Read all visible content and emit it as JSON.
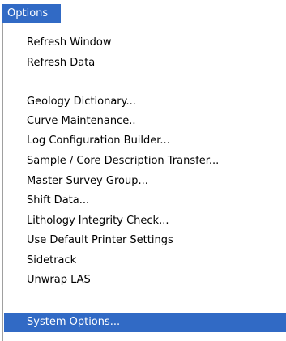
{
  "menubar": {
    "title": "Options"
  },
  "menu": {
    "items": [
      {
        "label": "Refresh Window"
      },
      {
        "label": "Refresh Data"
      },
      {
        "label": "Geology Dictionary..."
      },
      {
        "label": "Curve Maintenance.."
      },
      {
        "label": "Log Configuration Builder..."
      },
      {
        "label": "Sample / Core Description Transfer..."
      },
      {
        "label": "Master Survey Group..."
      },
      {
        "label": "Shift Data..."
      },
      {
        "label": "Lithology Integrity Check..."
      },
      {
        "label": "Use Default Printer Settings"
      },
      {
        "label": "Sidetrack"
      },
      {
        "label": "Unwrap LAS"
      },
      {
        "label": "System Options..."
      }
    ]
  },
  "colors": {
    "highlight": "#316ac5",
    "highlight_text": "#ffffff",
    "separator": "#a7a7a7"
  }
}
